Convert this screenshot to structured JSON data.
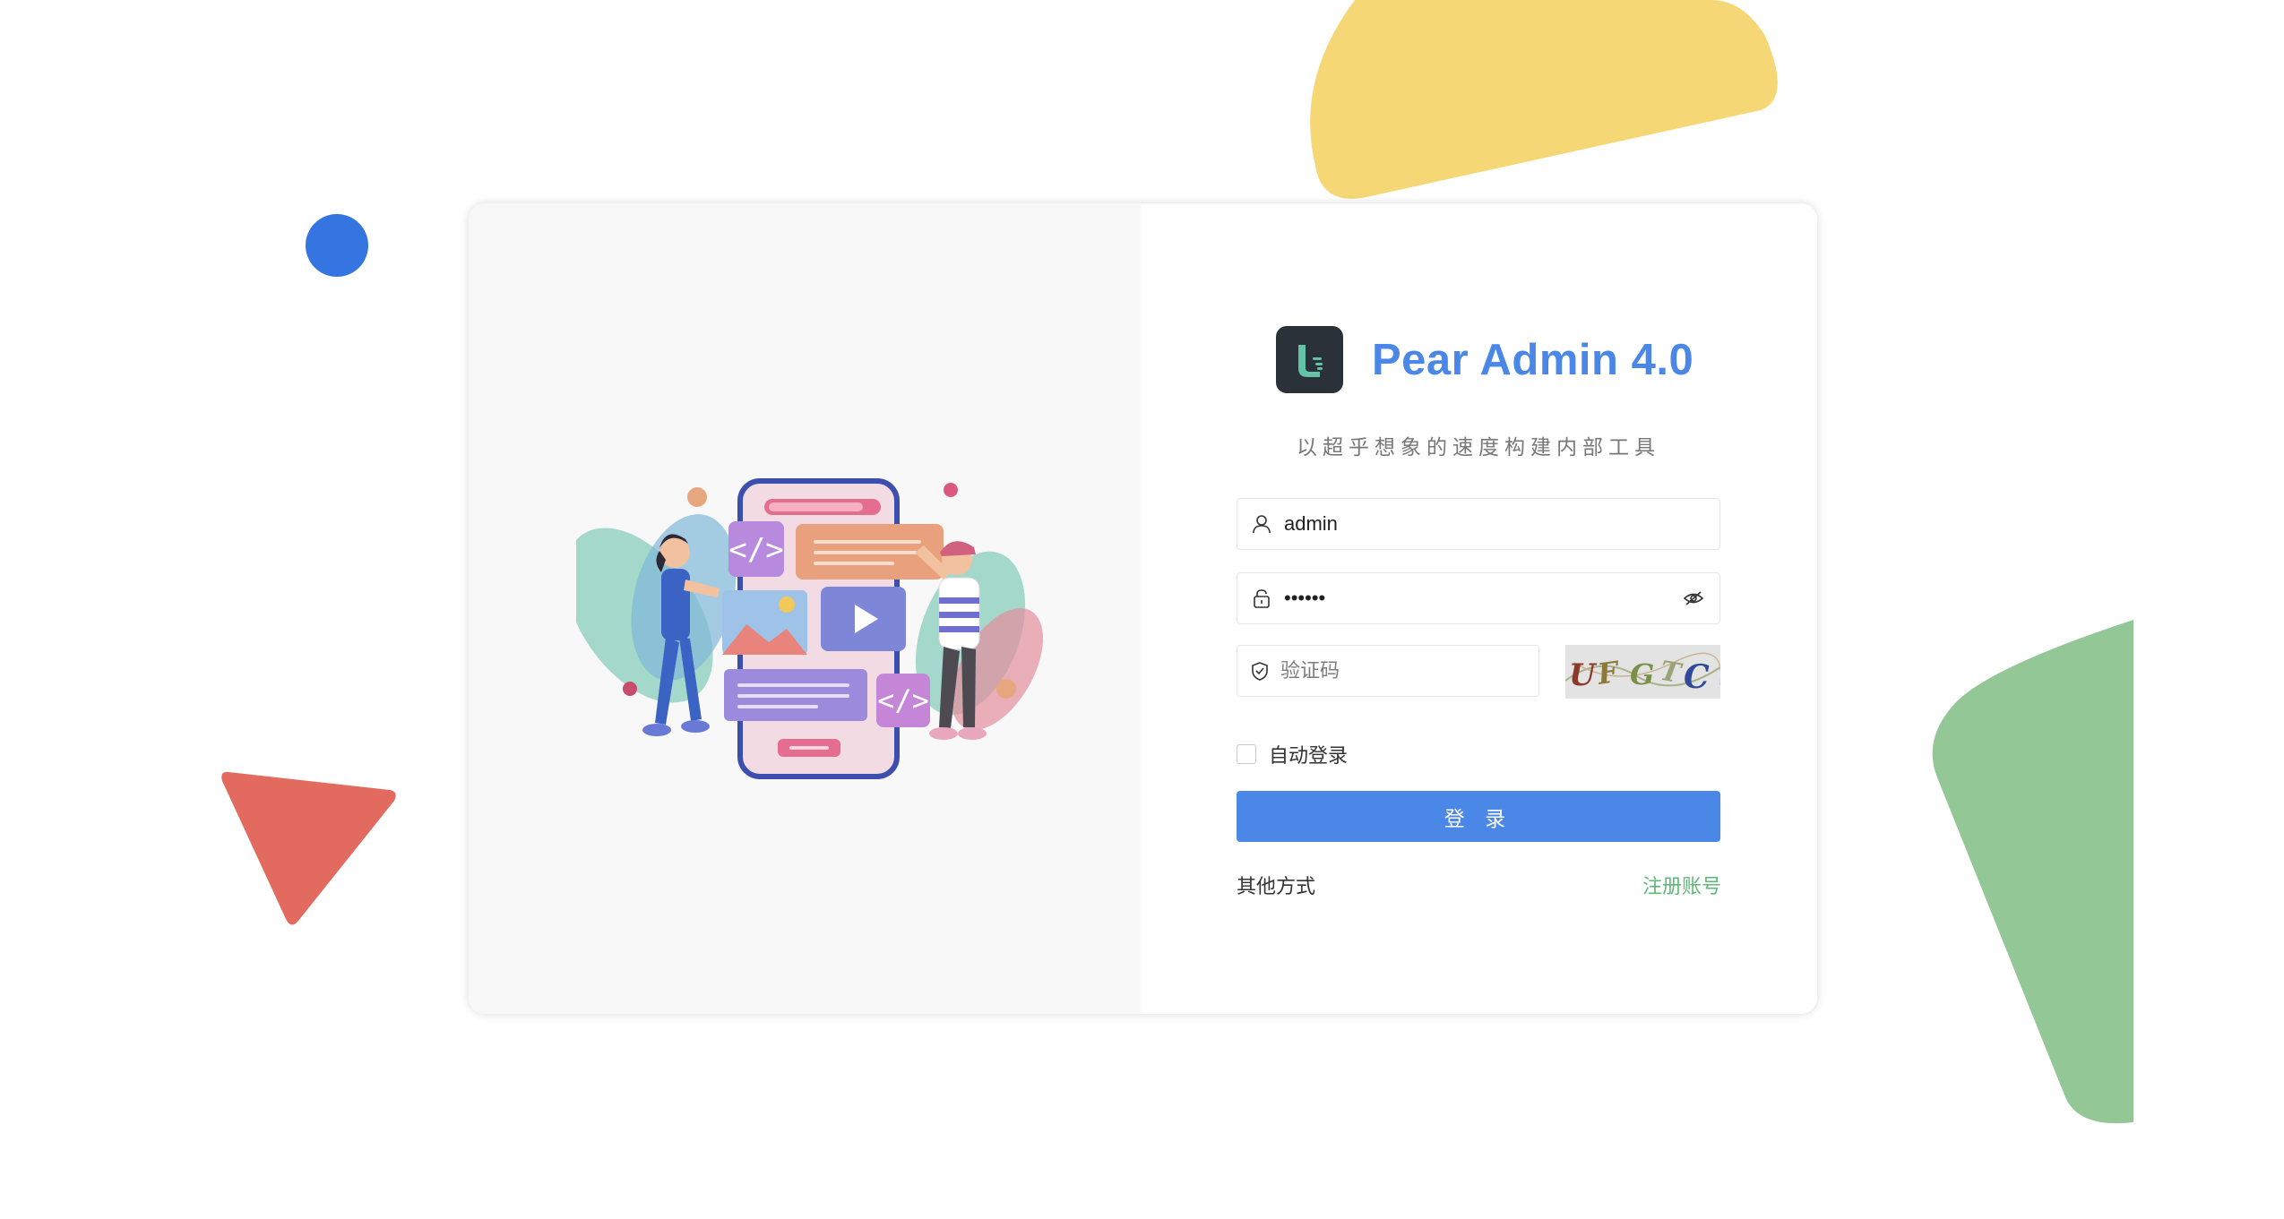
{
  "brand": {
    "title": "Pear Admin 4.0",
    "slogan": "以超乎想象的速度构建内部工具",
    "logo_icon": "pear-logo-icon"
  },
  "form": {
    "username": {
      "value": "admin",
      "icon": "user-icon"
    },
    "password": {
      "value": "••••••",
      "icon": "lock-icon",
      "toggle_icon": "eye-icon"
    },
    "captcha": {
      "placeholder": "验证码",
      "icon": "shield-check-icon",
      "image_text": "UFGTC"
    },
    "remember_label": "自动登录",
    "remember_checked": false,
    "login_label": "登 录",
    "other_methods_label": "其他方式",
    "register_label": "注册账号"
  },
  "colors": {
    "accent": "#4a87e6",
    "register_link": "#5fb878",
    "deco_yellow": "#f6d776",
    "deco_blue": "#3575e1",
    "deco_red": "#e26a5e",
    "deco_green": "#93c795"
  }
}
